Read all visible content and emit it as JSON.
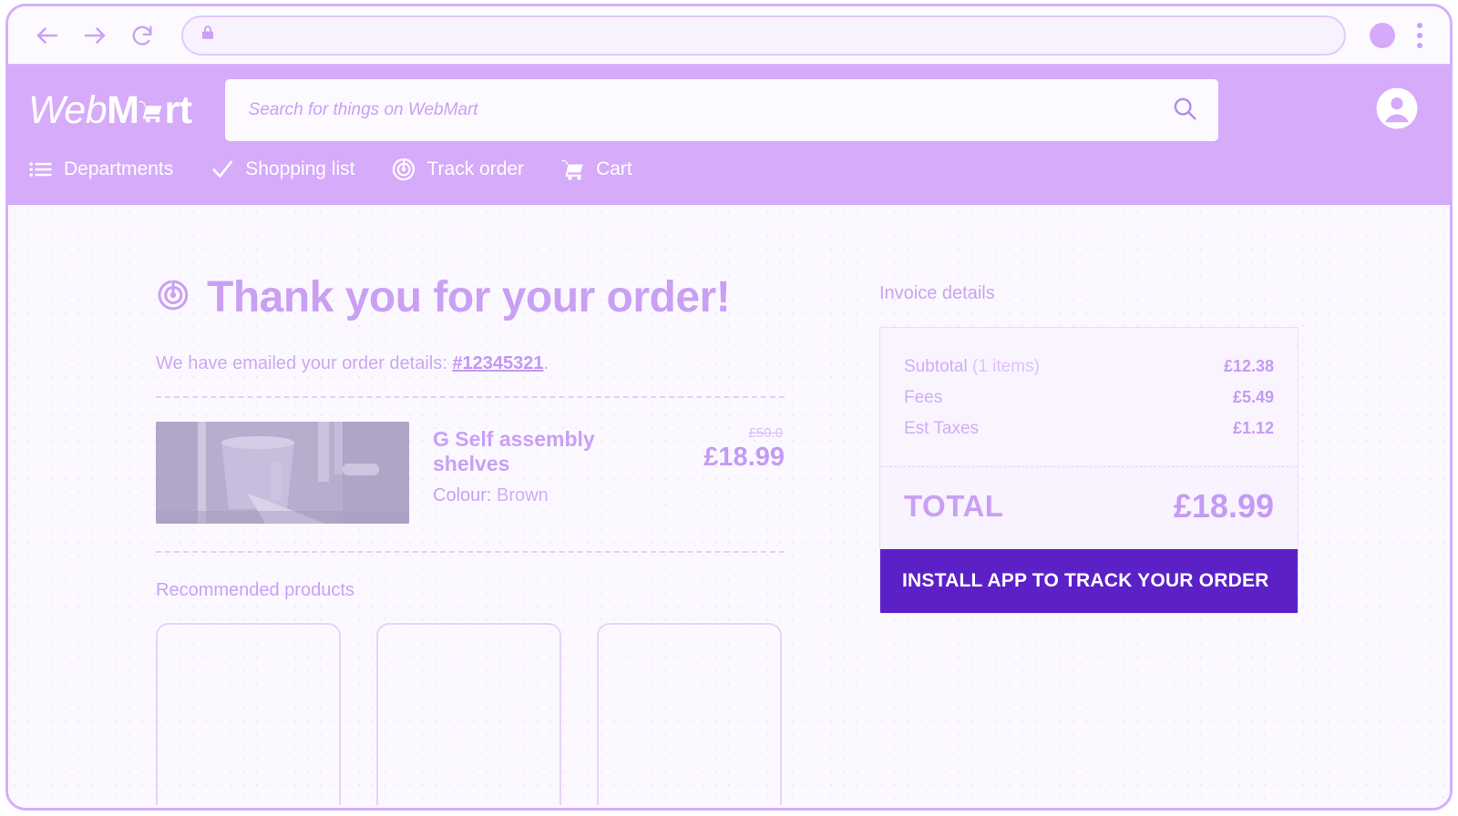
{
  "browser": {
    "back_icon": "back-arrow-icon",
    "forward_icon": "forward-arrow-icon",
    "reload_icon": "reload-icon",
    "lock_icon": "lock-icon",
    "url_value": "",
    "profile_icon": "profile-avatar-icon",
    "menu_icon": "kebab-menu-icon"
  },
  "header": {
    "logo": {
      "part1": "Web",
      "part2": "M",
      "cart_icon": "shopping-cart-icon",
      "part3": "rt"
    },
    "search": {
      "placeholder": "Search for things on WebMart",
      "value": "",
      "icon": "search-icon"
    },
    "account_icon": "account-circle-icon",
    "nav": [
      {
        "label": "Departments",
        "icon": "list-menu-icon"
      },
      {
        "label": "Shopping list",
        "icon": "checkmark-icon"
      },
      {
        "label": "Track order",
        "icon": "radar-target-icon"
      },
      {
        "label": "Cart",
        "icon": "shopping-cart-icon"
      }
    ]
  },
  "main": {
    "title": "Thank you for your order!",
    "title_icon": "radar-target-icon",
    "emailed_prefix": "We have emailed your order details: ",
    "order_number": "#12345321",
    "emailed_suffix": ".",
    "product": {
      "title": "G Self assembly shelves",
      "colour_label": "Colour:",
      "colour_value": "Brown",
      "price_old": "£50.0",
      "price_new": "£18.99",
      "image_alt": "product-photo"
    },
    "recommended_title": "Recommended products",
    "recommended_cards": [
      {
        "name": "recommended-card-1"
      },
      {
        "name": "recommended-card-2"
      },
      {
        "name": "recommended-card-3"
      }
    ]
  },
  "invoice": {
    "heading": "Invoice details",
    "rows": [
      {
        "label": "Subtotal",
        "note": " (1 items)",
        "value": "£12.38"
      },
      {
        "label": "Fees",
        "note": "",
        "value": "£5.49"
      },
      {
        "label": "Est Taxes",
        "note": "",
        "value": "£1.12"
      }
    ],
    "total_label": "TOTAL",
    "total_value": "£18.99",
    "install_button": "INSTALL APP TO TRACK YOUR ORDER"
  },
  "colors": {
    "brand_purple": "#d6abfa",
    "accent_deep_purple": "#5b21c7",
    "text_purple": "#c9a0f4",
    "border_purple": "#d4aefc",
    "page_bg": "#fbf9ff"
  }
}
